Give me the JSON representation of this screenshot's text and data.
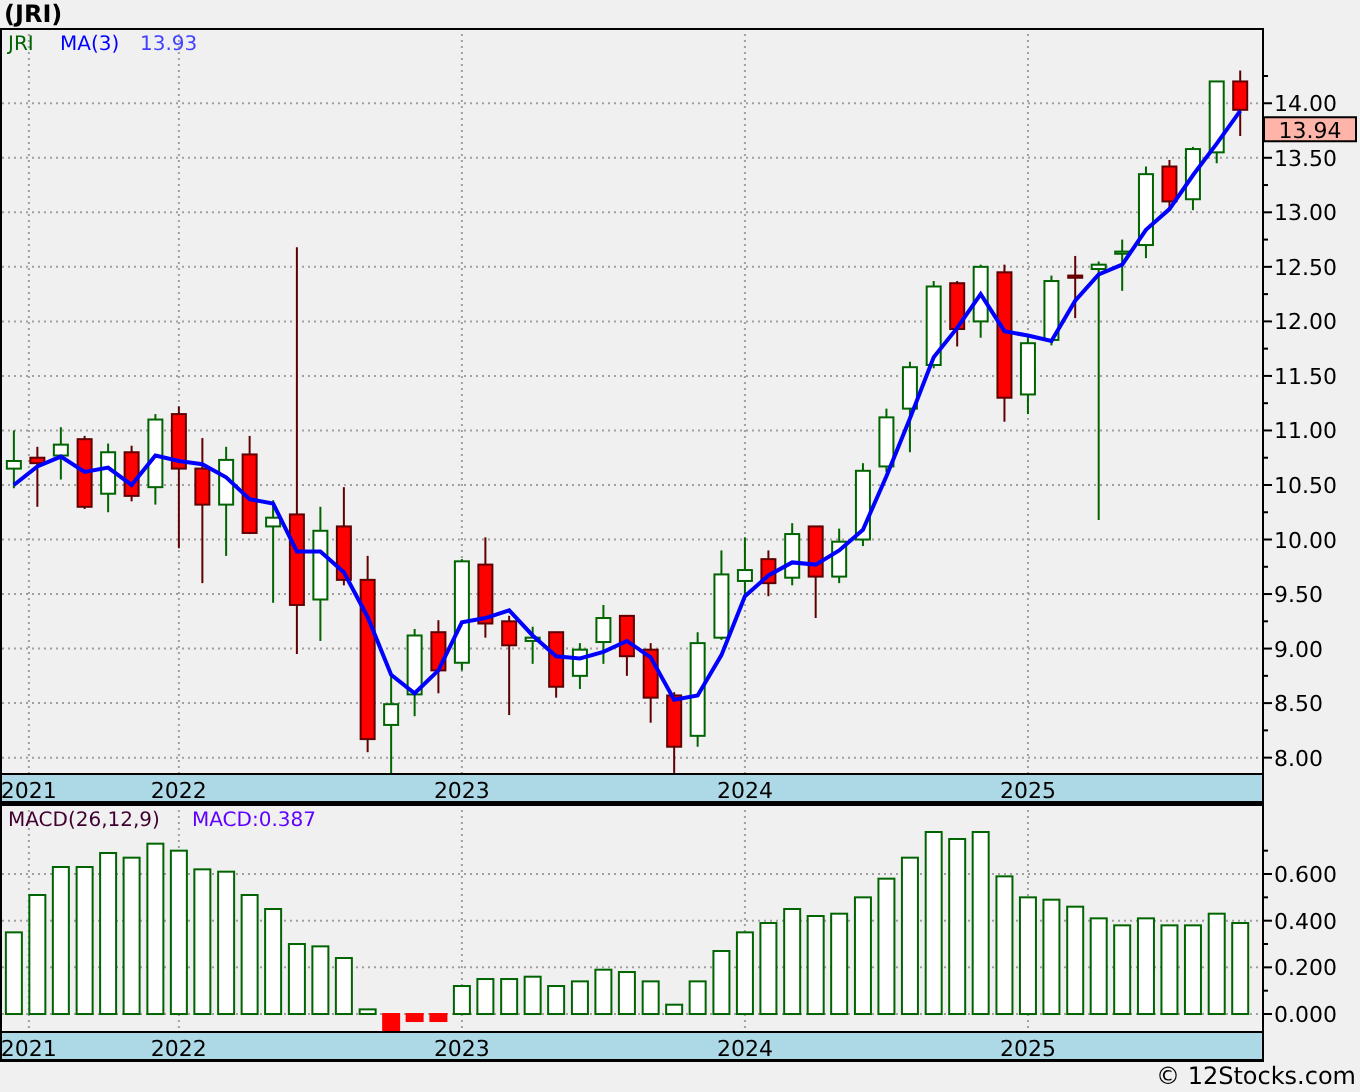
{
  "title": "(JRI)",
  "price_chart": {
    "symbol": "JRI",
    "ma_reading": "13.93",
    "last_price": "13.94",
    "chart_data": {
      "type": "candlestick",
      "grid": true,
      "ylim": [
        7.85,
        14.69
      ],
      "xlim": [
        2021.368,
        2025.827
      ],
      "yticks": [
        {
          "value": 8,
          "label": "8.00"
        },
        {
          "value": 8.5,
          "label": "8.50"
        },
        {
          "value": 9,
          "label": "9.00"
        },
        {
          "value": 9.5,
          "label": "9.50"
        },
        {
          "value": 10,
          "label": "10.00"
        },
        {
          "value": 10.5,
          "label": "10.50"
        },
        {
          "value": 11,
          "label": "11.00"
        },
        {
          "value": 11.5,
          "label": "11.50"
        },
        {
          "value": 12,
          "label": "12.00"
        },
        {
          "value": 12.5,
          "label": "12.50"
        },
        {
          "value": 13,
          "label": "13.00"
        },
        {
          "value": 13.5,
          "label": "13.50"
        },
        {
          "value": 14,
          "label": "14.00"
        }
      ],
      "x": [
        2021.417,
        2021.5,
        2021.583,
        2021.667,
        2021.75,
        2021.833,
        2021.917,
        2022,
        2022.083,
        2022.167,
        2022.25,
        2022.333,
        2022.417,
        2022.5,
        2022.583,
        2022.667,
        2022.75,
        2022.833,
        2022.917,
        2023,
        2023.083,
        2023.167,
        2023.25,
        2023.333,
        2023.417,
        2023.5,
        2023.583,
        2023.667,
        2023.75,
        2023.833,
        2023.917,
        2024,
        2024.083,
        2024.167,
        2024.25,
        2024.333,
        2024.417,
        2024.5,
        2024.583,
        2024.667,
        2024.75,
        2024.833,
        2024.917,
        2025,
        2025.083,
        2025.167,
        2025.25,
        2025.333,
        2025.417,
        2025.5,
        2025.583,
        2025.667,
        2025.75
      ],
      "xticks": [
        {
          "value": 2021.47,
          "label": "2021"
        },
        {
          "value": 2022,
          "label": "2022"
        },
        {
          "value": 2023,
          "label": "2023"
        },
        {
          "value": 2024,
          "label": "2024"
        },
        {
          "value": 2025,
          "label": "2025"
        }
      ],
      "series": [
        {
          "name": "MA(3)",
          "type": "line",
          "color": "#0000ff",
          "values": [
            10.5,
            10.67,
            10.76,
            10.62,
            10.66,
            10.5,
            10.77,
            10.72,
            10.69,
            10.57,
            10.37,
            10.33,
            9.89,
            9.89,
            9.7,
            9.29,
            8.76,
            8.59,
            8.8,
            9.24,
            9.28,
            9.35,
            9.12,
            8.93,
            8.91,
            8.97,
            9.07,
            8.92,
            8.53,
            8.57,
            8.94,
            9.48,
            9.67,
            9.79,
            9.77,
            9.9,
            10.09,
            10.58,
            11.11,
            11.67,
            11.94,
            12.25,
            11.91,
            11.87,
            11.82,
            12.19,
            12.43,
            12.52,
            12.84,
            13.03,
            13.34,
            13.63,
            13.93
          ]
        }
      ],
      "ohlc": [
        [
          10.65,
          11.0,
          10.47,
          10.72
        ],
        [
          10.75,
          10.85,
          10.3,
          10.7
        ],
        [
          10.77,
          11.03,
          10.55,
          10.87
        ],
        [
          10.92,
          10.95,
          10.28,
          10.3
        ],
        [
          10.42,
          10.88,
          10.25,
          10.8
        ],
        [
          10.8,
          10.86,
          10.35,
          10.4
        ],
        [
          10.48,
          11.15,
          10.32,
          11.1
        ],
        [
          11.15,
          11.22,
          9.92,
          10.65
        ],
        [
          10.65,
          10.93,
          9.6,
          10.32
        ],
        [
          10.32,
          10.85,
          9.85,
          10.73
        ],
        [
          10.78,
          10.95,
          10.05,
          10.06
        ],
        [
          10.12,
          10.36,
          9.42,
          10.2
        ],
        [
          10.23,
          12.68,
          8.95,
          9.4
        ],
        [
          9.45,
          10.3,
          9.07,
          10.08
        ],
        [
          10.12,
          10.48,
          9.58,
          9.63
        ],
        [
          9.63,
          9.85,
          8.05,
          8.17
        ],
        [
          8.3,
          8.75,
          7.85,
          8.49
        ],
        [
          8.58,
          9.18,
          8.38,
          9.12
        ],
        [
          9.15,
          9.26,
          8.59,
          8.8
        ],
        [
          8.87,
          9.82,
          8.8,
          9.8
        ],
        [
          9.77,
          10.02,
          9.1,
          9.23
        ],
        [
          9.25,
          9.3,
          8.39,
          9.03
        ],
        [
          9.07,
          9.2,
          8.86,
          9.1
        ],
        [
          9.15,
          9.15,
          8.55,
          8.65
        ],
        [
          8.75,
          9.05,
          8.63,
          8.99
        ],
        [
          9.06,
          9.4,
          8.86,
          9.28
        ],
        [
          9.3,
          9.3,
          8.75,
          8.93
        ],
        [
          8.99,
          9.05,
          8.32,
          8.55
        ],
        [
          8.57,
          8.6,
          7.86,
          8.1
        ],
        [
          8.2,
          9.15,
          8.1,
          9.05
        ],
        [
          9.1,
          9.9,
          9.08,
          9.68
        ],
        [
          9.62,
          10.02,
          9.45,
          9.72
        ],
        [
          9.82,
          9.9,
          9.48,
          9.6
        ],
        [
          9.65,
          10.15,
          9.58,
          10.05
        ],
        [
          10.12,
          10.12,
          9.28,
          9.66
        ],
        [
          9.66,
          10.1,
          9.6,
          9.98
        ],
        [
          10.0,
          10.7,
          9.94,
          10.63
        ],
        [
          10.67,
          11.2,
          10.62,
          11.12
        ],
        [
          11.2,
          11.63,
          10.8,
          11.58
        ],
        [
          11.6,
          12.37,
          11.57,
          12.32
        ],
        [
          12.35,
          12.37,
          11.77,
          11.93
        ],
        [
          12.0,
          12.52,
          11.85,
          12.5
        ],
        [
          12.45,
          12.52,
          11.08,
          11.3
        ],
        [
          11.33,
          11.88,
          11.15,
          11.8
        ],
        [
          11.83,
          12.42,
          11.78,
          12.37
        ],
        [
          12.42,
          12.6,
          12.03,
          12.4
        ],
        [
          12.48,
          12.55,
          10.18,
          12.52
        ],
        [
          12.62,
          12.75,
          12.28,
          12.64
        ],
        [
          12.7,
          13.42,
          12.58,
          13.35
        ],
        [
          13.42,
          13.48,
          13.03,
          13.1
        ],
        [
          13.12,
          13.6,
          13.02,
          13.58
        ],
        [
          13.55,
          14.2,
          13.45,
          14.2
        ],
        [
          14.2,
          14.3,
          13.7,
          13.94
        ]
      ]
    }
  },
  "macd_chart": {
    "reading": "MACD:0.387",
    "chart_data": {
      "type": "bar",
      "grid": true,
      "ylim": [
        -0.077,
        0.9
      ],
      "xlim": [
        2021.368,
        2025.827
      ],
      "yticks": [
        {
          "value": 0,
          "label": "0.000"
        },
        {
          "value": 0.2,
          "label": "0.200"
        },
        {
          "value": 0.4,
          "label": "0.400"
        },
        {
          "value": 0.6,
          "label": "0.600"
        }
      ],
      "x": [
        2021.417,
        2021.5,
        2021.583,
        2021.667,
        2021.75,
        2021.833,
        2021.917,
        2022,
        2022.083,
        2022.167,
        2022.25,
        2022.333,
        2022.417,
        2022.5,
        2022.583,
        2022.667,
        2022.75,
        2022.833,
        2022.917,
        2023,
        2023.083,
        2023.167,
        2023.25,
        2023.333,
        2023.417,
        2023.5,
        2023.583,
        2023.667,
        2023.75,
        2023.833,
        2023.917,
        2024,
        2024.083,
        2024.167,
        2024.25,
        2024.333,
        2024.417,
        2024.5,
        2024.583,
        2024.667,
        2024.75,
        2024.833,
        2024.917,
        2025,
        2025.083,
        2025.167,
        2025.25,
        2025.333,
        2025.417,
        2025.5,
        2025.583,
        2025.667,
        2025.75
      ],
      "xticks": [
        {
          "value": 2021.47,
          "label": "2021"
        },
        {
          "value": 2022,
          "label": "2022"
        },
        {
          "value": 2023,
          "label": "2023"
        },
        {
          "value": 2024,
          "label": "2024"
        },
        {
          "value": 2025,
          "label": "2025"
        }
      ],
      "series": [
        {
          "name": "MACD(26,12,9)",
          "color": "#006400",
          "values": [
            0.35,
            0.51,
            0.63,
            0.63,
            0.69,
            0.67,
            0.73,
            0.7,
            0.62,
            0.61,
            0.51,
            0.45,
            0.3,
            0.29,
            0.24,
            0.02,
            null,
            null,
            null,
            0.12,
            0.15,
            0.15,
            0.16,
            0.12,
            0.14,
            0.19,
            0.18,
            0.14,
            0.04,
            0.14,
            0.27,
            0.35,
            0.39,
            0.45,
            0.42,
            0.43,
            0.5,
            0.58,
            0.67,
            0.78,
            0.75,
            0.78,
            0.59,
            0.5,
            0.49,
            0.46,
            0.41,
            0.38,
            0.41,
            0.38,
            0.38,
            0.43,
            0.39
          ]
        },
        {
          "color": "#ff0000",
          "values": [
            null,
            null,
            null,
            null,
            null,
            null,
            null,
            null,
            null,
            null,
            null,
            null,
            null,
            null,
            null,
            null,
            -0.07,
            -0.03,
            -0.03,
            null,
            null,
            null,
            null,
            null,
            null,
            null,
            null,
            null,
            null,
            null,
            null,
            null,
            null,
            null,
            null,
            null,
            null,
            null,
            null,
            null,
            null,
            null,
            null,
            null,
            null,
            null,
            null,
            null,
            null,
            null,
            null,
            null,
            null
          ]
        }
      ]
    }
  },
  "footer": "© 12Stocks.com"
}
